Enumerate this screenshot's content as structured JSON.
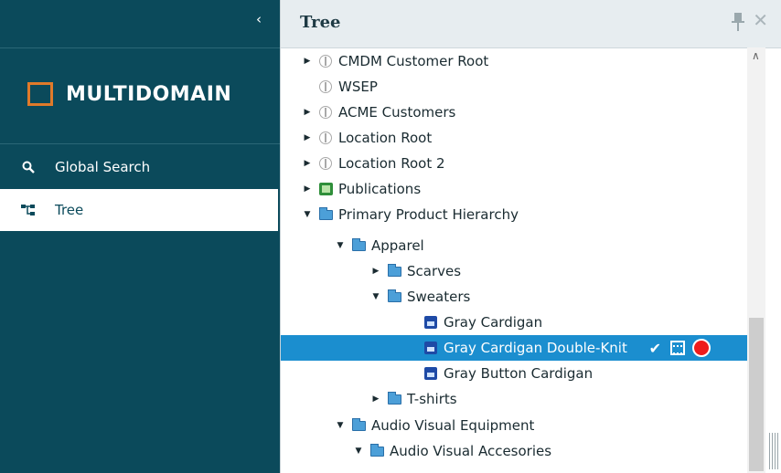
{
  "sidebar": {
    "collapse_icon": "chevron-left-icon",
    "brand": "MULTIDOMAIN",
    "nav": [
      {
        "label": "Global Search",
        "icon": "search-icon"
      },
      {
        "label": "Tree",
        "icon": "tree-icon"
      }
    ]
  },
  "panel": {
    "title": "Tree"
  },
  "tree": {
    "rows": [
      {
        "label": "CMDM Customer Root",
        "icon": "cube-icon",
        "expander": "collapsed"
      },
      {
        "label": "WSEP",
        "icon": "cube-icon",
        "expander": "none"
      },
      {
        "label": "ACME Customers",
        "icon": "cube-icon",
        "expander": "collapsed"
      },
      {
        "label": "Location Root",
        "icon": "cube-icon",
        "expander": "collapsed"
      },
      {
        "label": "Location Root 2",
        "icon": "cube-icon",
        "expander": "collapsed"
      },
      {
        "label": "Publications",
        "icon": "publication-icon",
        "expander": "collapsed"
      },
      {
        "label": "Primary Product Hierarchy",
        "icon": "folder-icon",
        "expander": "expanded"
      },
      {
        "label": "Apparel",
        "icon": "folder-icon",
        "expander": "expanded"
      },
      {
        "label": "Scarves",
        "icon": "folder-icon",
        "expander": "collapsed"
      },
      {
        "label": "Sweaters",
        "icon": "folder-icon",
        "expander": "expanded"
      },
      {
        "label": "Gray Cardigan",
        "icon": "product-icon",
        "expander": "none"
      },
      {
        "label": "Gray Cardigan Double-Knit",
        "icon": "product-icon",
        "expander": "none",
        "selected": true
      },
      {
        "label": "Gray Button Cardigan",
        "icon": "product-icon",
        "expander": "none"
      },
      {
        "label": "T-shirts",
        "icon": "folder-icon",
        "expander": "collapsed"
      },
      {
        "label": "Audio Visual Equipment",
        "icon": "folder-icon",
        "expander": "expanded"
      },
      {
        "label": "Audio Visual Accesories",
        "icon": "folder-icon",
        "expander": "expanded"
      }
    ],
    "selected_actions": [
      "check-icon",
      "grid-icon",
      "status-dot"
    ],
    "status_color": "#ee1c1c"
  },
  "colors": {
    "sidebar_bg": "#0b4a5b",
    "brand_accent": "#e07a2a",
    "selection": "#1b8ecf"
  }
}
